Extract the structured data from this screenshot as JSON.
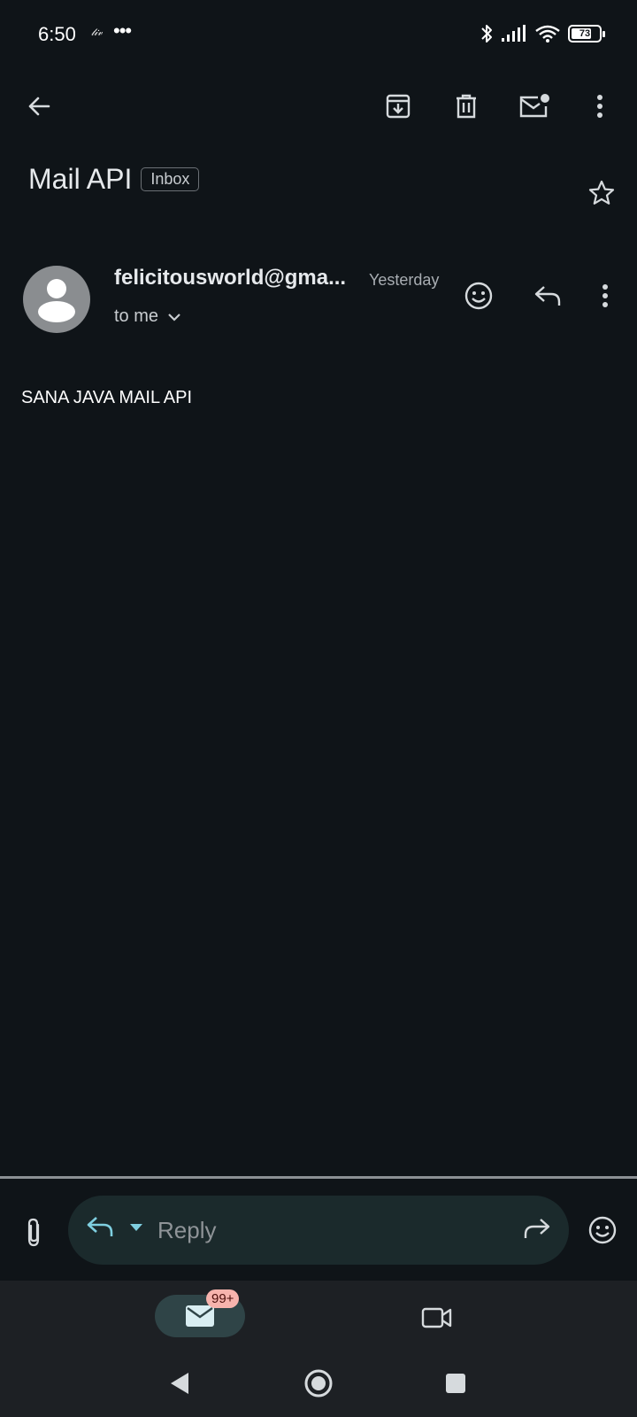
{
  "status_bar": {
    "time": "6:50",
    "app_indicator": "𝓁𝒾𝓋",
    "more": "•••",
    "battery_level": 73,
    "battery_label": "73",
    "icons": [
      "bluetooth-icon",
      "signal-icon",
      "wifi-icon",
      "battery-icon"
    ]
  },
  "toolbar": {
    "icons": [
      "back-arrow-icon",
      "archive-icon",
      "delete-icon",
      "mark-unread-icon",
      "more-vert-icon"
    ]
  },
  "email": {
    "subject": "Mail API",
    "label": "Inbox",
    "sender": "felicitousworld@gma...",
    "date": "Yesterday",
    "recipient": "to me",
    "body": "SANA JAVA MAIL API"
  },
  "reply_bar": {
    "placeholder": "Reply",
    "icons": [
      "attachment-icon",
      "reply-icon",
      "caret-down-icon",
      "forward-icon",
      "emoji-icon"
    ]
  },
  "bottom_nav": {
    "mail_badge": "99+",
    "icons": [
      "mail-icon",
      "video-camera-icon"
    ]
  },
  "system_nav": {
    "icons": [
      "system-back-icon",
      "home-icon",
      "recents-icon"
    ]
  },
  "colors": {
    "background": "#0f1418",
    "reply_box": "#1b2a2c",
    "accent": "#7fcfe0",
    "badge": "#f7b3ad",
    "nav_active": "#2f4447"
  }
}
